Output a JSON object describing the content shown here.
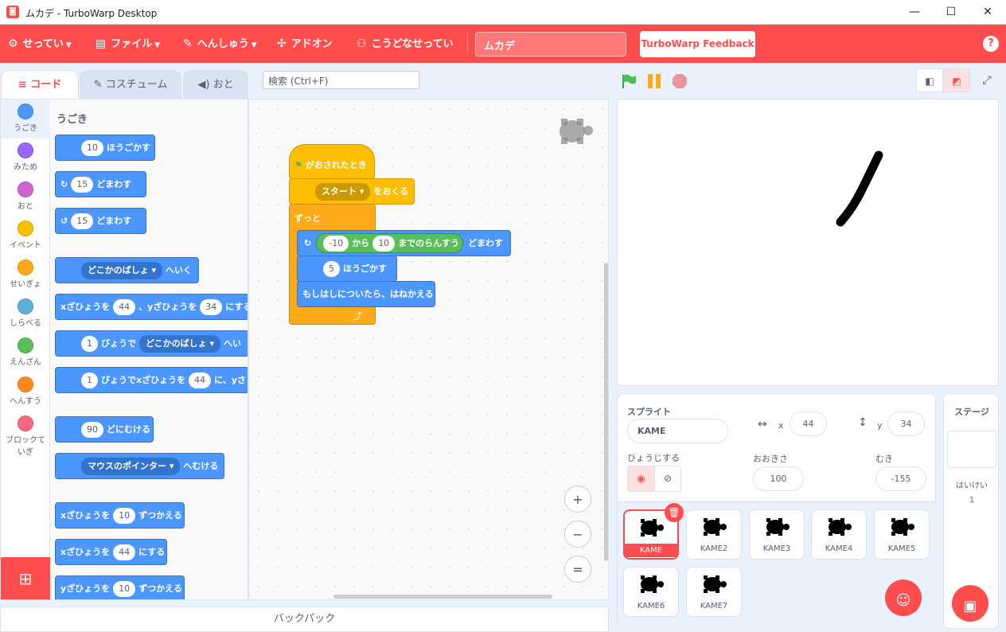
{
  "window": {
    "title": "ムカデ - TurboWarp Desktop",
    "min": "—",
    "max": "☐",
    "close": "✕"
  },
  "menu": {
    "settings": "せってい",
    "file": "ファイル",
    "edit": "へんしゅう",
    "addons": "アドオン",
    "howto": "こうどなせってい",
    "project_title": "ムカデ",
    "feedback": "TurboWarp Feedback",
    "help": "?"
  },
  "tabs": {
    "code": "コード",
    "costume": "コスチューム",
    "sound": "おと"
  },
  "search": {
    "placeholder": "検索 (Ctrl+F)"
  },
  "categories": [
    {
      "label": "うごき",
      "color": "#4c97ff"
    },
    {
      "label": "みため",
      "color": "#9966ff"
    },
    {
      "label": "おと",
      "color": "#cf63cf"
    },
    {
      "label": "イベント",
      "color": "#ffbf00"
    },
    {
      "label": "せいぎょ",
      "color": "#ffab19"
    },
    {
      "label": "しらべる",
      "color": "#5cb1d6"
    },
    {
      "label": "えんざん",
      "color": "#59c059"
    },
    {
      "label": "へんすう",
      "color": "#ff8c1a"
    },
    {
      "label": "ブロックていぎ",
      "color": "#ff6680"
    }
  ],
  "palette": {
    "heading": "うごき",
    "b1": {
      "val": "10",
      "text": "ほうごかす"
    },
    "b2": {
      "val": "15",
      "text": "どまわす"
    },
    "b3": {
      "val": "15",
      "text": "どまわす"
    },
    "b4": {
      "drop": "どこかのばしょ",
      "text": "へいく"
    },
    "b5": {
      "t1": "xざひょうを",
      "v1": "44",
      "t2": "、yざひょうを",
      "v2": "34",
      "t3": "にする"
    },
    "b6": {
      "v1": "1",
      "t1": "びょうで",
      "drop": "どこかのばしょ",
      "t2": "へい"
    },
    "b7": {
      "v1": "1",
      "t1": "びょうでxざひょうを",
      "v2": "44",
      "t2": "に、yさ"
    },
    "b8": {
      "val": "90",
      "text": "どにむける"
    },
    "b9": {
      "drop": "マウスのポインター",
      "text": "へむける"
    },
    "b10": {
      "t1": "xざひょうを",
      "v": "10",
      "t2": "ずつかえる"
    },
    "b11": {
      "t1": "xざひょうを",
      "v": "44",
      "t2": "にする"
    },
    "b12": {
      "t1": "yざひょうを",
      "v": "10",
      "t2": "ずつかえる"
    }
  },
  "script": {
    "hat": "がおされたとき",
    "send": {
      "drop": "スタート",
      "text": "をおくる"
    },
    "forever": "ずっと",
    "turn": {
      "v1": "-10",
      "t1": "から",
      "v2": "10",
      "t2": "までのらんすう",
      "t3": "どまわす"
    },
    "move": {
      "val": "5",
      "text": "ほうごかす"
    },
    "bounce": "もしはしについたら、はねかえる"
  },
  "zoom": {
    "in": "+",
    "out": "−",
    "reset": "="
  },
  "sprite_info": {
    "sprite_label": "スプライト",
    "name": "KAME",
    "x_label": "x",
    "x": "44",
    "y_label": "y",
    "y": "34",
    "show_label": "ひょうじする",
    "size_label": "おおきさ",
    "size": "100",
    "direction_label": "むき",
    "direction": "-155"
  },
  "sprites": [
    "KAME",
    "KAME2",
    "KAME3",
    "KAME4",
    "KAME5",
    "KAME6",
    "KAME7"
  ],
  "stage_pane": {
    "label": "ステージ",
    "backdrops_label": "はいけい",
    "backdrops": "1"
  },
  "backpack": "バックパック"
}
